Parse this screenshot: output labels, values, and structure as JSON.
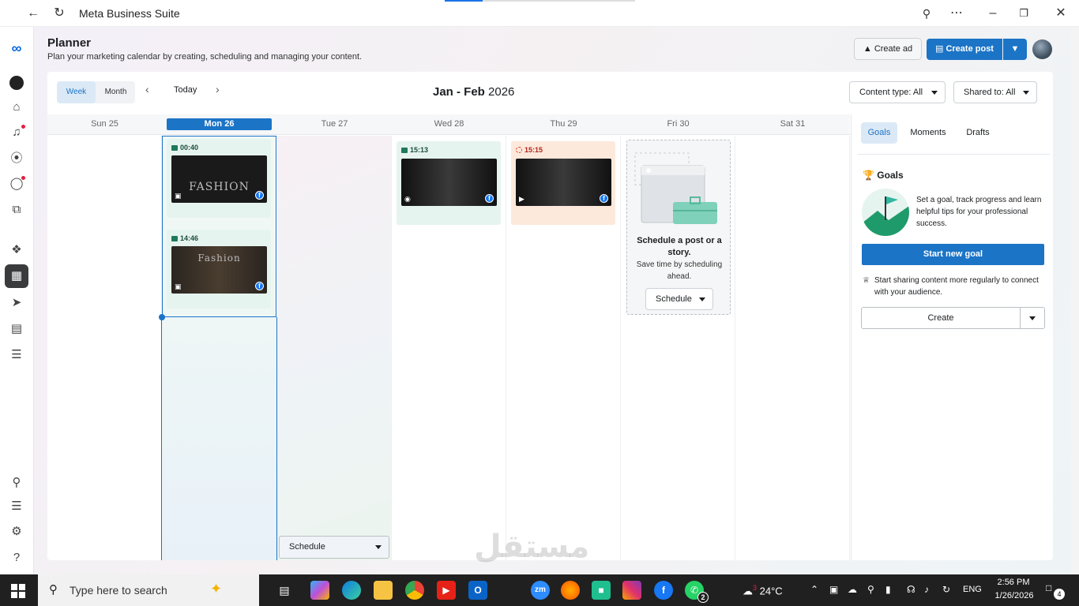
{
  "window": {
    "title": "Meta Business Suite"
  },
  "header": {
    "title": "Planner",
    "subtitle": "Plan your marketing calendar by creating, scheduling and managing your content.",
    "create_ad": "Create ad",
    "create_post": "Create post"
  },
  "toolbar": {
    "week": "Week",
    "month": "Month",
    "today": "Today",
    "range_bold": "Jan - Feb",
    "range_year": "2026",
    "content_type": "Content type: All",
    "shared_to": "Shared to: All"
  },
  "days": [
    "Sun 25",
    "Mon 26",
    "Tue 27",
    "Wed 28",
    "Thu 29",
    "Fri 30",
    "Sat 31"
  ],
  "posts": [
    {
      "time": "00:40",
      "thumb_text": "FASHION"
    },
    {
      "time": "14:46",
      "thumb_text": "Fashion"
    },
    {
      "time": "15:13",
      "thumb_text": ""
    },
    {
      "time": "15:15",
      "thumb_text": ""
    }
  ],
  "empty_slot": {
    "title": "Schedule a post or a story.",
    "subtitle": "Save time by scheduling ahead.",
    "button": "Schedule"
  },
  "tue_schedule": "Schedule",
  "right_panel": {
    "tabs": [
      "Goals",
      "Moments",
      "Drafts"
    ],
    "goals_heading": "Goals",
    "goal_text": "Set a goal, track progress and learn helpful tips for your professional success.",
    "start_goal": "Start new goal",
    "share_text": "Start sharing content more regularly to connect with your audience.",
    "create": "Create"
  },
  "taskbar": {
    "search_placeholder": "Type here to search",
    "temperature": "24°C",
    "weather_badge": "3",
    "language": "ENG",
    "time": "2:56 PM",
    "date": "1/26/2026",
    "notifications": "4",
    "whatsapp_badge": "2"
  },
  "colors": {
    "primary": "#1b74c6",
    "active_day": "#1b74c6",
    "post_green": "#e6f4ef",
    "post_orange": "#fde9dc"
  }
}
